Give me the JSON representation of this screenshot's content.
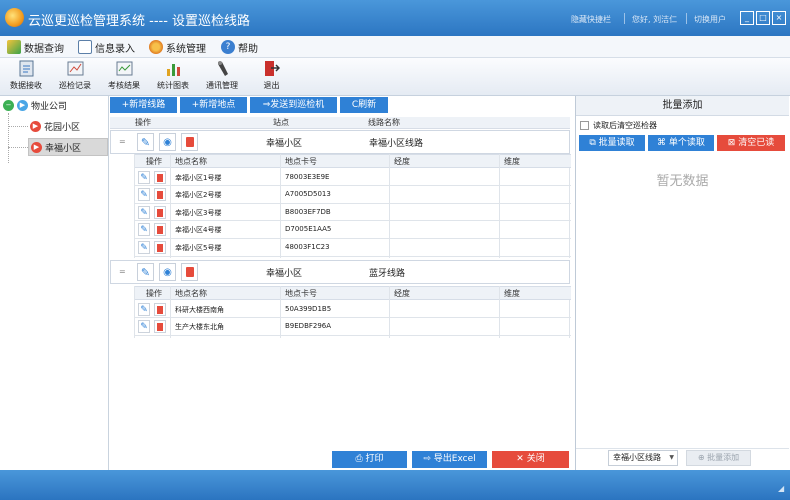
{
  "window": {
    "title": "云巡更巡检管理系统 ---- 设置巡检线路",
    "links": [
      "隐藏快捷栏",
      "您好, 刘洁仁",
      "切换用户"
    ]
  },
  "menu": [
    "数据查询",
    "信息录入",
    "系统管理",
    "帮助"
  ],
  "toolbar": [
    "数据接收",
    "巡检记录",
    "考核结果",
    "统计图表",
    "通讯管理",
    "退出"
  ],
  "tree": {
    "root": "物业公司",
    "children": [
      "花园小区",
      "幸福小区"
    ]
  },
  "main": {
    "actions": [
      "+新增线路",
      "+新增地点",
      "⇒发送到巡检机",
      "C刷新"
    ],
    "grid_headers": [
      "操作",
      "站点",
      "线路名称"
    ],
    "sub_headers": [
      "操作",
      "地点名称",
      "地点卡号",
      "经度",
      "维度"
    ],
    "routes": [
      {
        "station": "幸福小区",
        "name": "幸福小区线路",
        "points": [
          {
            "name": "幸福小区1号楼",
            "card": "78003E3E9E",
            "lng": "",
            "lat": ""
          },
          {
            "name": "幸福小区2号楼",
            "card": "A7005D5013",
            "lng": "",
            "lat": ""
          },
          {
            "name": "幸福小区3号楼",
            "card": "B8003EF7DB",
            "lng": "",
            "lat": ""
          },
          {
            "name": "幸福小区4号楼",
            "card": "D7005E1AA5",
            "lng": "",
            "lat": ""
          },
          {
            "name": "幸福小区5号楼",
            "card": "48003F1C23",
            "lng": "",
            "lat": ""
          }
        ]
      },
      {
        "station": "幸福小区",
        "name": "蓝牙线路",
        "points": [
          {
            "name": "科研大楼西南角",
            "card": "50A399D1B5",
            "lng": "",
            "lat": ""
          },
          {
            "name": "生产大楼东北角",
            "card": "B9EDBF296A",
            "lng": "",
            "lat": ""
          }
        ]
      }
    ],
    "footer_buttons": [
      "打印",
      "导出Excel",
      "关闭"
    ]
  },
  "right_panel": {
    "title": "批量添加",
    "checkbox_label": "读取后清空巡检器",
    "buttons": [
      "批量读取",
      "单个读取",
      "清空已读"
    ],
    "empty_text": "暂无数据",
    "select_value": "幸福小区线路",
    "add_button": "批量添加"
  },
  "colors": {
    "title_blue": "#2f7bcf",
    "button_blue": "#2f81d6",
    "danger_red": "#e64b3c",
    "selected_bg": "#d9d9d9"
  }
}
